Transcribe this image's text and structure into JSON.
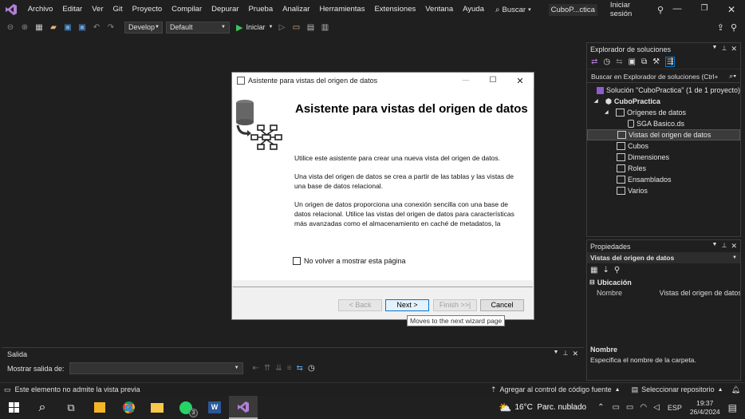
{
  "menu": [
    "Archivo",
    "Editar",
    "Ver",
    "Git",
    "Proyecto",
    "Compilar",
    "Depurar",
    "Prueba",
    "Analizar",
    "Herramientas",
    "Extensiones",
    "Ventana",
    "Ayuda"
  ],
  "search_label": "Buscar",
  "window_title": "CuboP...ctica",
  "signin_label": "Iniciar sesión",
  "toolbar": {
    "config": "Develop",
    "platform": "Default",
    "start_label": "Iniciar"
  },
  "solution_explorer": {
    "title": "Explorador de soluciones",
    "search_placeholder": "Buscar en Explorador de soluciones (Ctrl+",
    "solution": "Solución \"CuboPractica\" (1 de 1 proyecto)",
    "project": "CuboPractica",
    "data_sources": "Orígenes de datos",
    "ds_file": "SGA Basico.ds",
    "selected": "Vistas del origen de datos",
    "items": [
      "Cubos",
      "Dimensiones",
      "Roles",
      "Ensamblados",
      "Varios"
    ]
  },
  "properties": {
    "title": "Propiedades",
    "object": "Vistas del origen de datos",
    "category": "Ubicación",
    "prop_name": "Nombre",
    "prop_value": "Vistas del origen de datos",
    "desc_title": "Nombre",
    "desc_text": "Especifica el nombre de la carpeta."
  },
  "output": {
    "title": "Salida",
    "show_from": "Mostrar salida de:"
  },
  "status": {
    "preview": "Este elemento no admite la vista previa",
    "source_control": "Agregar al control de código fuente",
    "repo": "Seleccionar repositorio"
  },
  "dialog": {
    "title": "Asistente para vistas del origen de datos",
    "heading": "Asistente para vistas del origen de datos",
    "p1": "Utilice este asistente para crear una nueva vista del origen de datos.",
    "p2": " Una vista del origen de datos se crea a partir de las tablas y las vistas de una base de datos relacional.",
    "p3": " Un origen de datos proporciona una conexión sencilla con una base de datos relacional. Utilice las vistas del origen de datos para características más avanzadas como el almacenamiento en caché de metadatos, la",
    "checkbox": "No volver a mostrar esta página",
    "back": "< Back",
    "next": "Next >",
    "finish": "Finish >>|",
    "cancel": "Cancel",
    "tooltip": "Moves to the next wizard page"
  },
  "taskbar": {
    "weather": "16°C  Parc. nublado",
    "lang": "ESP",
    "time": "19:37",
    "date": "26/4/2024",
    "whatsapp_badge": "3"
  },
  "colors": {
    "vs_purple": "#8f5ccf",
    "selection": "#3b3b3b",
    "accent": "#0078d4"
  }
}
